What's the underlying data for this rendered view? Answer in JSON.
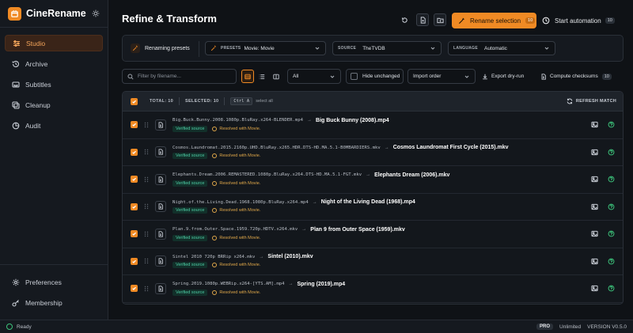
{
  "app": {
    "name": "CineRename"
  },
  "sidebar": {
    "items": [
      {
        "label": "Studio",
        "icon": "sliders-icon",
        "active": true
      },
      {
        "label": "Archive",
        "icon": "history-icon"
      },
      {
        "label": "Subtitles",
        "icon": "subtitles-icon"
      },
      {
        "label": "Cleanup",
        "icon": "layers-icon"
      },
      {
        "label": "Audit",
        "icon": "audit-icon"
      }
    ],
    "bottom": [
      {
        "label": "Preferences",
        "icon": "gear-icon"
      },
      {
        "label": "Membership",
        "icon": "key-icon"
      }
    ]
  },
  "header": {
    "title": "Refine & Transform",
    "rename_label": "Rename selection",
    "rename_count": "10",
    "automation_label": "Start automation",
    "automation_count": "10"
  },
  "presets": {
    "label": "Renaming presets",
    "preset_tag": "PRESETS",
    "preset_value": "Movie: Movie",
    "source_tag": "SOURCE",
    "source_value": "TheTVDB",
    "language_tag": "LANGUAGE",
    "language_value": "Automatic"
  },
  "toolbar": {
    "search_placeholder": "Filter by filename...",
    "filter_value": "All",
    "hide_unchanged": "Hide unchanged",
    "order_value": "Import order",
    "export_label": "Export dry-run",
    "checksum_label": "Compute checksums",
    "checksum_count": "10"
  },
  "table": {
    "total": "TOTAL: 10",
    "selected": "SELECTED: 10",
    "shortcut_key": "Ctrl A",
    "shortcut_hint": "select all",
    "refresh_label": "REFRESH MATCH",
    "verified_label": "Verified source",
    "resolved_label": "Resolved with Movie.",
    "rows": [
      {
        "orig": "Big.Buck.Bunny.2008.1080p.BluRay.x264-BLENDER.mp4",
        "new": "Big Buck Bunny (2008).mp4"
      },
      {
        "orig": "Cosmos.Laundromat.2015.2160p.UHD.BluRay.x265.HDR.DTS-HD.MA.5.1-B0MBARDIERS.mkv",
        "new": "Cosmos Laundromat First Cycle (2015).mkv"
      },
      {
        "orig": "Elephants.Dream.2006.REMASTERED.1080p.BluRay.x264.DTS-HD.MA.5.1-FGT.mkv",
        "new": "Elephants Dream (2006).mkv"
      },
      {
        "orig": "Night.of.the.Living.Dead.1968.1080p.BluRay.x264.mp4",
        "new": "Night of the Living Dead (1968).mp4"
      },
      {
        "orig": "Plan.9.from.Outer.Space.1959.720p.HDTV.x264.mkv",
        "new": "Plan 9 from Outer Space (1959).mkv"
      },
      {
        "orig": "Sintel 2010 720p BRRip x264.mkv",
        "new": "Sintel (2010).mkv"
      },
      {
        "orig": "Spring.2019.1080p.WEBRip.x264-[YTS.AM].mp4",
        "new": "Spring (2019).mp4"
      }
    ]
  },
  "status": {
    "text": "Ready",
    "plan": "PRO",
    "license": "Unlimited",
    "version": "VERSION V0.5.0"
  },
  "colors": {
    "accent": "#f08a24",
    "success": "#3cc27a",
    "verified": "#4ecfa6",
    "resolved": "#e0a84a"
  }
}
